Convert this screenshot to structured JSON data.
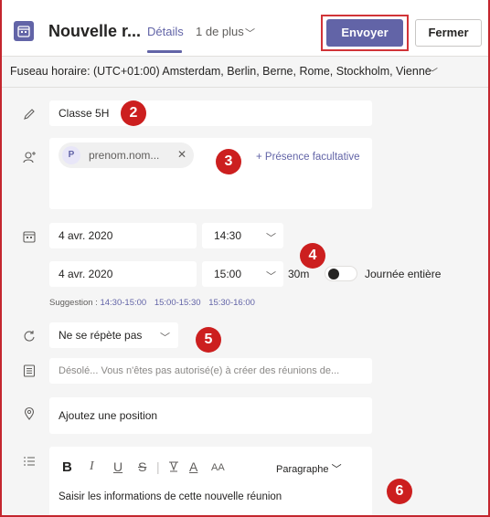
{
  "header": {
    "title": "Nouvelle r...",
    "tab_details": "Détails",
    "tab_more": "1 de plus",
    "send_label": "Envoyer",
    "close_label": "Fermer"
  },
  "timezone": {
    "label": "Fuseau horaire: (UTC+01:00) Amsterdam, Berlin, Berne, Rome, Stockholm, Vienne"
  },
  "form": {
    "title_value": "Classe 5H",
    "attendee": {
      "initial": "P",
      "name": "prenom.nom..."
    },
    "optional_link": "+ Présence facultative",
    "start_date": "4 avr. 2020",
    "start_time": "14:30",
    "end_date": "4 avr. 2020",
    "end_time": "15:00",
    "duration": "30m",
    "all_day_label": "Journée entière",
    "all_day_on": false,
    "suggestion_label": "Suggestion :",
    "suggestions": [
      "14:30-15:00",
      "15:00-15:30",
      "15:30-16:00"
    ],
    "repeat_value": "Ne se répète pas",
    "channel_placeholder": "Désolé... Vous n'êtes pas autorisé(e) à créer des réunions de...",
    "location_placeholder": "Ajoutez une position",
    "editor": {
      "bold": "B",
      "italic": "I",
      "underline": "U",
      "strike": "S",
      "highlight": "A",
      "font_size": "AA",
      "paragraph": "Paragraphe",
      "body": "Saisir les informations de cette nouvelle réunion"
    }
  },
  "annotations": [
    "2",
    "3",
    "4",
    "5",
    "6"
  ],
  "colors": {
    "accent": "#6264a7",
    "badge": "#cc1f1f",
    "highlight_border": "#d13438"
  }
}
